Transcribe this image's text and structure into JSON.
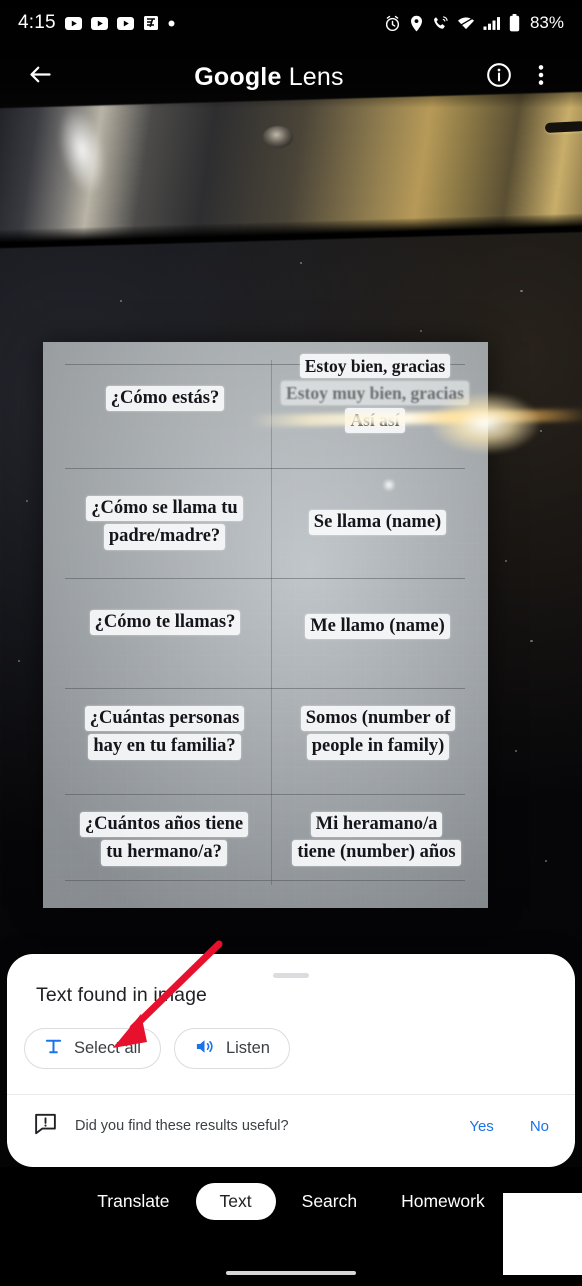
{
  "status_bar": {
    "time": "4:15",
    "left_icons": [
      "youtube-icon",
      "youtube-icon",
      "youtube-icon",
      "news-icon",
      "dot-icon"
    ],
    "right_icons": [
      "alarm-icon",
      "location-icon",
      "call-icon",
      "wifi-icon",
      "signal-icon",
      "battery-icon"
    ],
    "battery_percent": "83%"
  },
  "title_bar": {
    "back_icon": "back-arrow-icon",
    "title_bold": "Google",
    "title_regular": " Lens",
    "info_icon": "info-icon",
    "overflow_icon": "more-vertical-icon"
  },
  "photo": {
    "paper": {
      "rows": [
        {
          "question": [
            "¿Cómo estás?"
          ],
          "answer": [
            "Estoy bien, gracias",
            "Estoy muy bien, gracias",
            "Así así"
          ]
        },
        {
          "question": [
            "¿Cómo se llama tu",
            "padre/madre?"
          ],
          "answer": [
            "Se llama (name)"
          ]
        },
        {
          "question": [
            "¿Cómo te llamas?"
          ],
          "answer": [
            "Me llamo (name)"
          ]
        },
        {
          "question": [
            "¿Cuántas personas",
            "hay en tu familia?"
          ],
          "answer": [
            "Somos (number of",
            "people in family)"
          ]
        },
        {
          "question": [
            "¿Cuántos años tiene",
            "tu hermano/a?"
          ],
          "answer": [
            "Mi heramano/a",
            "tiene (number) años"
          ]
        }
      ]
    }
  },
  "sheet": {
    "title": "Text found in image",
    "chips": [
      {
        "label": "Select all",
        "icon": "select-text-icon"
      },
      {
        "label": "Listen",
        "icon": "speaker-icon"
      }
    ],
    "feedback": {
      "icon": "feedback-icon",
      "question": "Did you find these results useful?",
      "yes": "Yes",
      "no": "No"
    }
  },
  "mode_bar": {
    "modes": [
      {
        "label": "Translate",
        "active": false
      },
      {
        "label": "Text",
        "active": true
      },
      {
        "label": "Search",
        "active": false
      },
      {
        "label": "Homework",
        "active": false
      }
    ]
  },
  "annotation": {
    "arrow_color": "#e8112d",
    "points_to": "Select all"
  },
  "colors": {
    "accent_blue": "#1a73e8",
    "sheet_bg": "#ffffff",
    "bar_bg": "#000000",
    "text_primary": "#202124"
  }
}
